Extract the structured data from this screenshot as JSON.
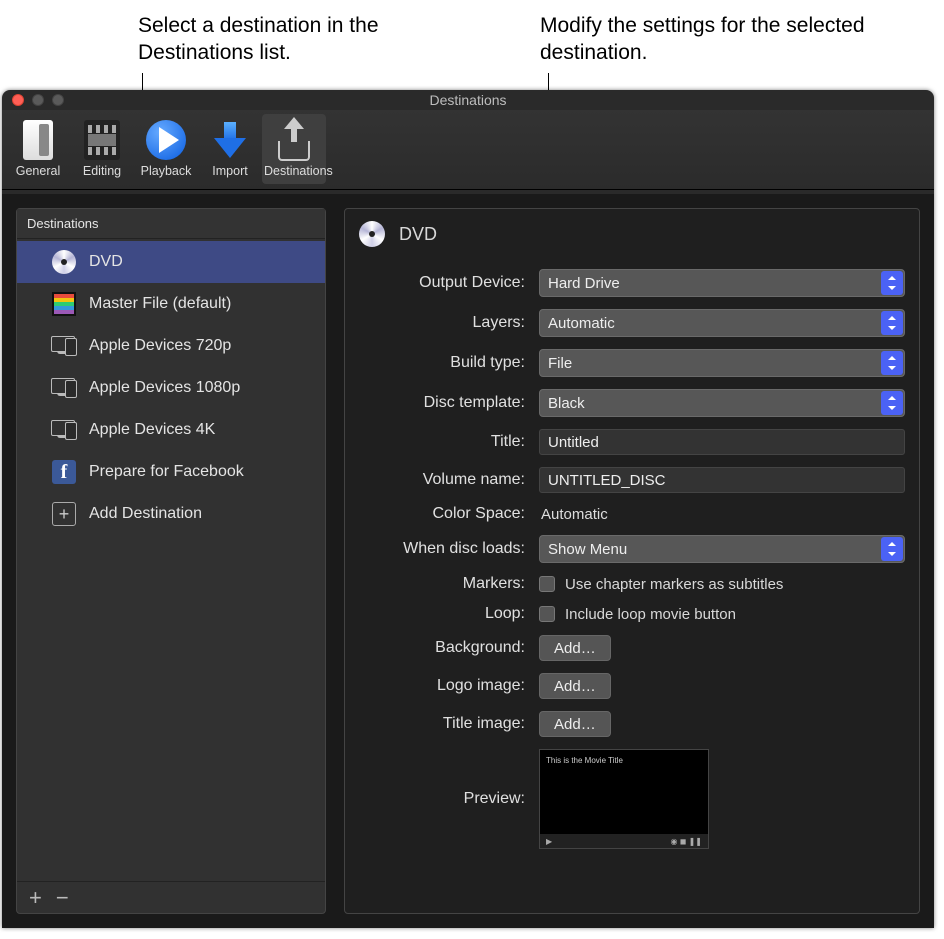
{
  "callouts": {
    "left": "Select a destination in the Destinations list.",
    "right": "Modify the settings for the selected destination."
  },
  "window": {
    "title": "Destinations"
  },
  "toolbar": {
    "items": [
      {
        "label": "General"
      },
      {
        "label": "Editing"
      },
      {
        "label": "Playback"
      },
      {
        "label": "Import"
      },
      {
        "label": "Destinations"
      }
    ]
  },
  "sidebar": {
    "header": "Destinations",
    "items": [
      {
        "label": "DVD"
      },
      {
        "label": "Master File (default)"
      },
      {
        "label": "Apple Devices 720p"
      },
      {
        "label": "Apple Devices 1080p"
      },
      {
        "label": "Apple Devices 4K"
      },
      {
        "label": "Prepare for Facebook"
      },
      {
        "label": "Add Destination"
      }
    ],
    "footer": {
      "add": "+",
      "remove": "−"
    }
  },
  "detail": {
    "title": "DVD",
    "rows": {
      "output_device": {
        "label": "Output Device:",
        "value": "Hard Drive"
      },
      "layers": {
        "label": "Layers:",
        "value": "Automatic"
      },
      "build_type": {
        "label": "Build type:",
        "value": "File"
      },
      "disc_template": {
        "label": "Disc template:",
        "value": "Black"
      },
      "title": {
        "label": "Title:",
        "value": "Untitled"
      },
      "volume_name": {
        "label": "Volume name:",
        "value": "UNTITLED_DISC"
      },
      "color_space": {
        "label": "Color Space:",
        "value": "Automatic"
      },
      "when_disc_loads": {
        "label": "When disc loads:",
        "value": "Show Menu"
      },
      "markers": {
        "label": "Markers:",
        "checkbox_label": "Use chapter markers as subtitles"
      },
      "loop": {
        "label": "Loop:",
        "checkbox_label": "Include loop movie button"
      },
      "background": {
        "label": "Background:",
        "button": "Add…"
      },
      "logo_image": {
        "label": "Logo image:",
        "button": "Add…"
      },
      "title_image": {
        "label": "Title image:",
        "button": "Add…"
      },
      "preview": {
        "label": "Preview:",
        "placeholder_title": "This is the Movie Title"
      }
    }
  }
}
